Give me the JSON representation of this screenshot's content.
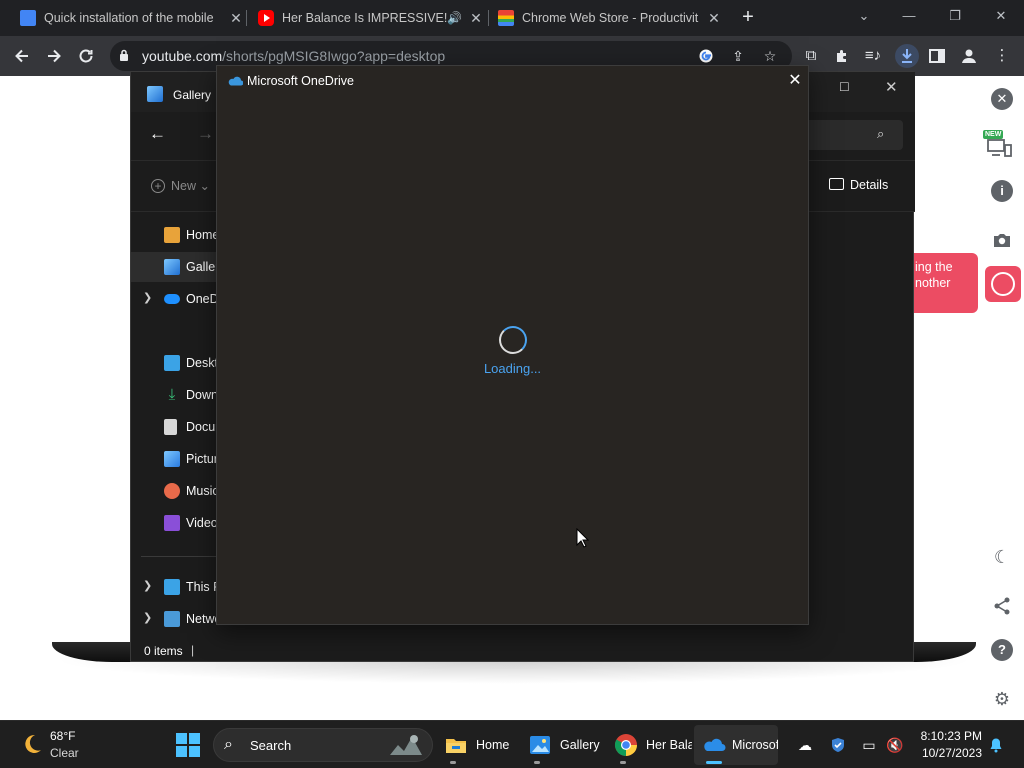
{
  "browser": {
    "tabs": [
      {
        "title": "Quick installation of the mobile",
        "icon": "docs-icon",
        "active": false
      },
      {
        "title": "Her Balance Is IMPRESSIVE!",
        "icon": "youtube-icon",
        "active": true
      },
      {
        "title": "Chrome Web Store - Productivit",
        "icon": "webstore-icon",
        "active": false
      }
    ],
    "new_tab_glyph": "+",
    "window_controls": {
      "dropdown": "⌄",
      "minimize": "—",
      "maximize": "❐",
      "close": "✕"
    },
    "url_host": "youtube.com",
    "url_path": "/shorts/pgMSIG8Iwgo?app=desktop"
  },
  "explorer": {
    "title": "Gallery",
    "new_label": "New",
    "details_label": "Details",
    "nav_items": [
      {
        "label": "Home",
        "icon": "home-icon"
      },
      {
        "label": "Gallery",
        "icon": "gallery-icon"
      },
      {
        "label": "OneDrive",
        "icon": "onedrive-icon"
      },
      {
        "label": "Desktop",
        "icon": "desktop-icon"
      },
      {
        "label": "Downloads",
        "icon": "downloads-icon"
      },
      {
        "label": "Documents",
        "icon": "documents-icon"
      },
      {
        "label": "Pictures",
        "icon": "pictures-icon"
      },
      {
        "label": "Music",
        "icon": "music-icon"
      },
      {
        "label": "Videos",
        "icon": "videos-icon"
      },
      {
        "label": "This PC",
        "icon": "this-pc-icon"
      },
      {
        "label": "Network",
        "icon": "network-icon"
      }
    ],
    "status": "0 items"
  },
  "onedrive_dialog": {
    "title": "Microsoft OneDrive",
    "loading_text": "Loading..."
  },
  "recorder": {
    "bubble_text_line1": "ing the",
    "bubble_text_line2": "nother",
    "new_badge": "NEW"
  },
  "taskbar": {
    "weather_temp": "68°F",
    "weather_condition": "Clear",
    "search_label": "Search",
    "apps": [
      {
        "label": "Home",
        "icon": "file-explorer-icon"
      },
      {
        "label": "Gallery",
        "icon": "gallery-icon"
      },
      {
        "label": "Her Bala",
        "icon": "chrome-icon"
      },
      {
        "label": "Microsof",
        "icon": "onedrive-icon"
      }
    ],
    "clock_time": "8:10:23 PM",
    "clock_date": "10/27/2023"
  },
  "colors": {
    "accent": "#4cc2ff",
    "onedrive_blue": "#4aa3f0",
    "recorder_pink": "#ec4c63",
    "youtube_red": "#ff0000"
  }
}
